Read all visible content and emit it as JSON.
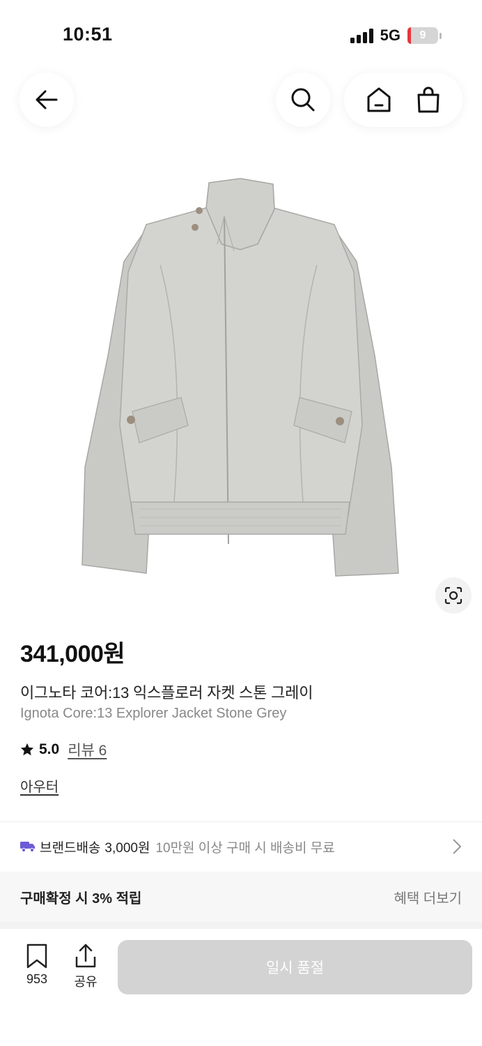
{
  "status_bar": {
    "time": "10:51",
    "network": "5G",
    "battery": "9",
    "battery_level": 0.09
  },
  "nav": {
    "back_icon": "arrow-left-icon",
    "search_icon": "search-icon",
    "home_icon": "home-icon",
    "cart_icon": "shopping-bag-icon"
  },
  "product": {
    "image_alt": "stone grey jacket",
    "price": "341,000원",
    "title_ko": "이그노타 코어:13 익스플로러 자켓 스톤 그레이",
    "title_en": "Ignota Core:13 Explorer Jacket Stone Grey",
    "rating": "5.0",
    "review_label": "리뷰 6",
    "category": "아우터"
  },
  "shipping": {
    "brand_label": "브랜드배송",
    "fee": "3,000원",
    "note": "10만원 이상 구매 시 배송비 무료"
  },
  "benefit": {
    "text": "구매확정 시 3% 적립",
    "link": "혜택 더보기"
  },
  "bottom": {
    "bookmark_count": "953",
    "share_label": "공유",
    "soldout_label": "일시 품절"
  },
  "colors": {
    "accent_truck": "#6b5bd6",
    "battery_low": "#e5373c",
    "soldout_bg": "#d3d3d3"
  }
}
